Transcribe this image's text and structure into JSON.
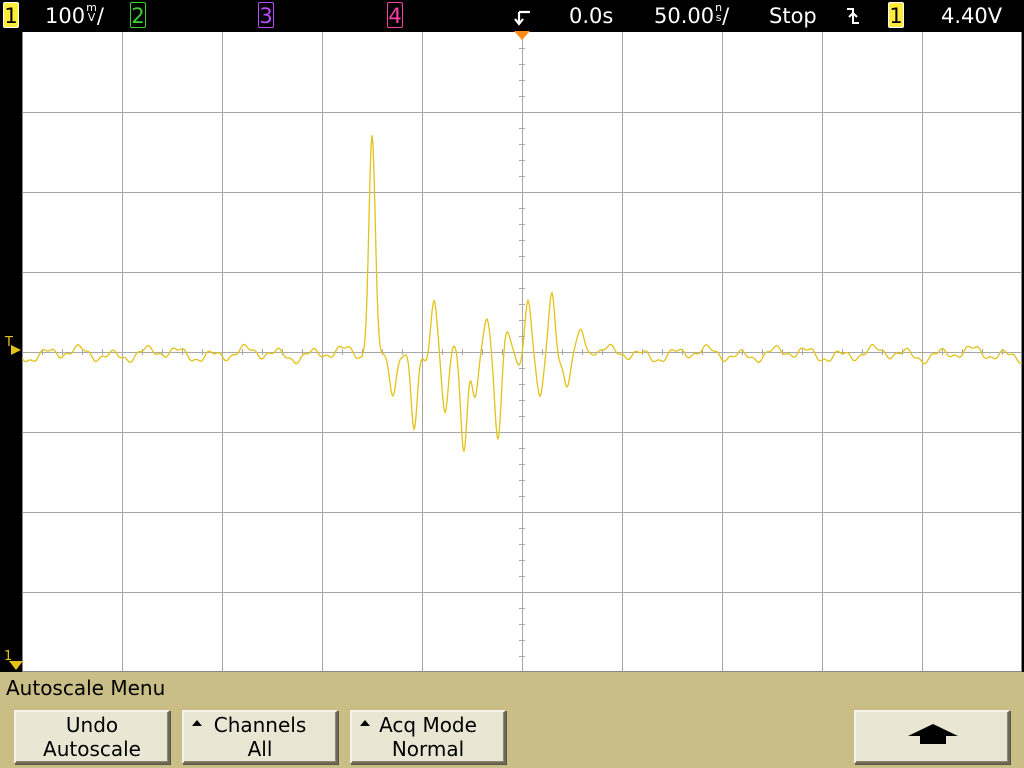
{
  "status_bar": {
    "channel1": {
      "label": "1",
      "scale": "100",
      "unit_top": "m",
      "unit_bottom": "V",
      "suffix": "/"
    },
    "channel2": {
      "label": "2"
    },
    "channel3": {
      "label": "3"
    },
    "channel4": {
      "label": "4"
    },
    "time_position": "0.0s",
    "timebase": {
      "value": "50.00",
      "unit_top": "n",
      "unit_bottom": "s",
      "suffix": "/"
    },
    "run_state": "Stop",
    "trigger_slope_icon": "falling-edge-icon",
    "trigger_source": "1",
    "trigger_level": "4.40V"
  },
  "colors": {
    "channel1": "#e3c21a",
    "channel2": "#39d32c",
    "channel3": "#b94cff",
    "channel4": "#ff3ea5",
    "trigger_marker": "#ff8c1a",
    "menu_bg": "#c9bf86"
  },
  "screen": {
    "trigger_level_marker": "T",
    "channel1_ground_marker": "1"
  },
  "menu": {
    "title": "Autoscale Menu",
    "softkeys": [
      {
        "line1": "Undo",
        "line2": "Autoscale"
      },
      {
        "line1": "Channels",
        "line2": "All"
      },
      {
        "line1": "Acq Mode",
        "line2": "Normal"
      }
    ],
    "back_icon": "up-arrow-icon"
  }
}
